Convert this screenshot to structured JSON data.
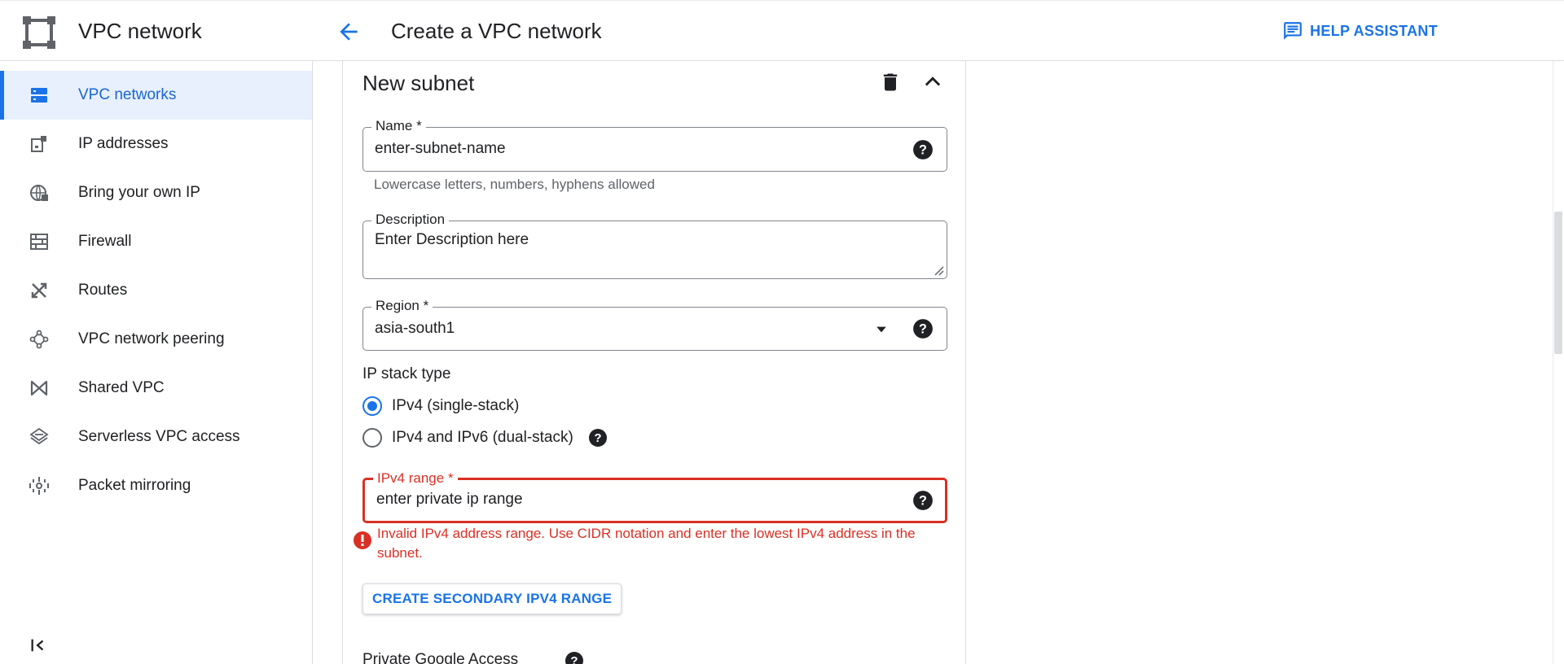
{
  "app": {
    "title": "VPC network"
  },
  "header": {
    "title": "Create a VPC network",
    "help_label": "HELP ASSISTANT"
  },
  "sidebar": {
    "items": [
      {
        "label": "VPC networks",
        "icon": "vpc-networks-icon",
        "active": true
      },
      {
        "label": "IP addresses",
        "icon": "ip-addresses-icon"
      },
      {
        "label": "Bring your own IP",
        "icon": "globe-icon"
      },
      {
        "label": "Firewall",
        "icon": "firewall-icon"
      },
      {
        "label": "Routes",
        "icon": "routes-icon"
      },
      {
        "label": "VPC network peering",
        "icon": "peering-icon"
      },
      {
        "label": "Shared VPC",
        "icon": "shared-vpc-icon"
      },
      {
        "label": "Serverless VPC access",
        "icon": "serverless-icon"
      },
      {
        "label": "Packet mirroring",
        "icon": "packet-mirroring-icon"
      }
    ]
  },
  "subnet": {
    "title": "New subnet",
    "name": {
      "label": "Name *",
      "value": "enter-subnet-name",
      "hint": "Lowercase letters, numbers, hyphens allowed"
    },
    "description": {
      "label": "Description",
      "value": "Enter Description here"
    },
    "region": {
      "label": "Region *",
      "value": "asia-south1"
    },
    "ip_stack": {
      "label": "IP stack type",
      "options": [
        {
          "label": "IPv4 (single-stack)",
          "checked": true
        },
        {
          "label": "IPv4 and IPv6 (dual-stack)",
          "checked": false
        }
      ]
    },
    "ipv4_range": {
      "label": "IPv4 range *",
      "value": "enter private ip range",
      "error": "Invalid IPv4 address range. Use CIDR notation and enter the lowest IPv4 address in the subnet."
    },
    "secondary_button": "CREATE SECONDARY IPV4 RANGE",
    "private_google_access": "Private Google Access"
  },
  "colors": {
    "accent": "#1a73e8",
    "error": "#d93025",
    "active_bg": "#e8f0fe"
  }
}
